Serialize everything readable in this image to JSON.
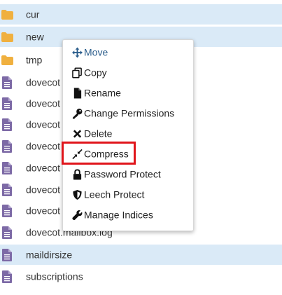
{
  "files": [
    {
      "name": "cur",
      "type": "folder",
      "selected": true
    },
    {
      "name": "new",
      "type": "folder",
      "selected": true
    },
    {
      "name": "tmp",
      "type": "folder",
      "selected": false
    },
    {
      "name": "dovecot",
      "type": "file",
      "selected": false
    },
    {
      "name": "dovecot",
      "type": "file",
      "selected": false
    },
    {
      "name": "dovecot",
      "type": "file",
      "selected": false
    },
    {
      "name": "dovecot",
      "type": "file",
      "selected": false
    },
    {
      "name": "dovecot",
      "type": "file",
      "selected": false
    },
    {
      "name": "dovecot",
      "type": "file",
      "selected": false
    },
    {
      "name": "dovecot",
      "type": "file",
      "selected": false
    },
    {
      "name": "dovecot.mailbox.log",
      "type": "file",
      "selected": false
    },
    {
      "name": "maildirsize",
      "type": "file",
      "selected": true
    },
    {
      "name": "subscriptions",
      "type": "file",
      "selected": false
    }
  ],
  "context_menu": {
    "items": [
      {
        "label": "Move",
        "icon": "move-arrows-icon"
      },
      {
        "label": "Copy",
        "icon": "copy-icon"
      },
      {
        "label": "Rename",
        "icon": "file-icon"
      },
      {
        "label": "Change Permissions",
        "icon": "key-icon"
      },
      {
        "label": "Delete",
        "icon": "x-icon"
      },
      {
        "label": "Compress",
        "icon": "compress-icon"
      },
      {
        "label": "Password Protect",
        "icon": "lock-icon"
      },
      {
        "label": "Leech Protect",
        "icon": "shield-icon"
      },
      {
        "label": "Manage Indices",
        "icon": "wrench-icon"
      }
    ],
    "highlighted_item": "Compress"
  },
  "colors": {
    "folder": "#f0b03f",
    "file": "#7d6aa6",
    "selected_row": "#daeaf7",
    "highlight": "#e0151b",
    "move_link": "#2b5d8c"
  }
}
